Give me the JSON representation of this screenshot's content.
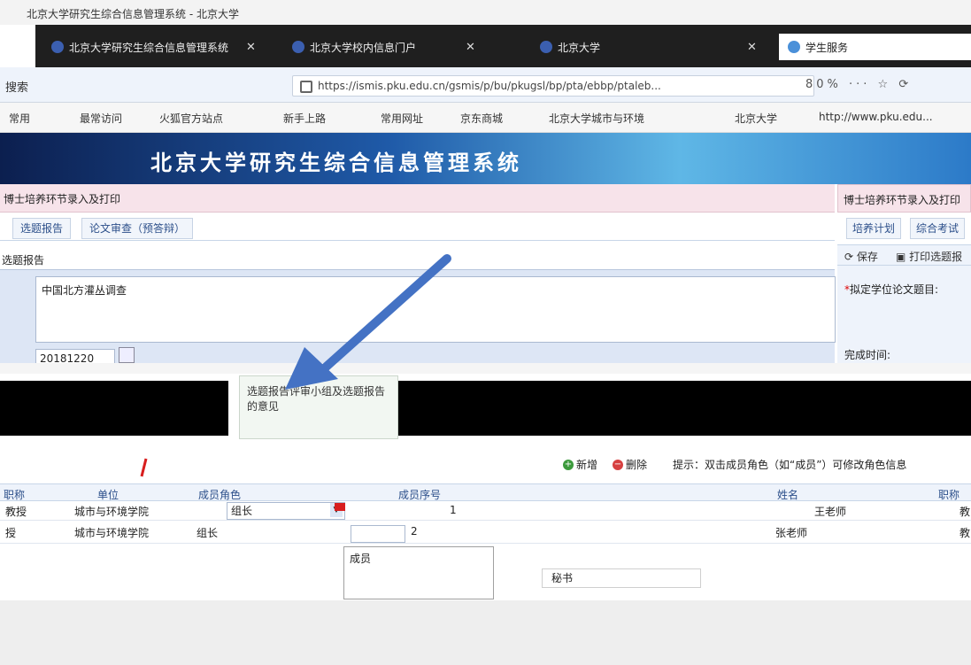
{
  "window": {
    "title": "北京大学研究生综合信息管理系统 - 北京大学"
  },
  "tabs": [
    {
      "label": "北京大学研究生综合信息管理系统",
      "close": "✕"
    },
    {
      "label": "北京大学校内信息门户",
      "close": "✕"
    },
    {
      "label": "北京大学",
      "close": "✕"
    },
    {
      "label": "学生服务"
    }
  ],
  "address": {
    "left": "搜索",
    "url": "https://ismis.pku.edu.cn/gsmis/p/bu/pkugsl/bp/pta/ebbp/ptaleb...",
    "tools": "80% ··· ☆ ⟳"
  },
  "bookmarks": [
    "常用",
    "最常访问",
    "火狐官方站点",
    "新手上路",
    "常用网址",
    "京东商城",
    "北京大学城市与环境",
    "北京大学",
    "http://www.pku.edu..."
  ],
  "banner": {
    "title": "北京大学研究生综合信息管理系统"
  },
  "main": {
    "header": "博士培养环节录入及打印",
    "tabs": [
      "选题报告",
      "论文审查（预答辩）"
    ],
    "section_label": "选题报告",
    "topic": "中国北方灌丛调查",
    "date": "20181220"
  },
  "right_panel": {
    "header": "博士培养环节录入及打印",
    "tabs": [
      "培养计划",
      "综合考试"
    ],
    "save_label": "保存",
    "print_label": "打印选题报",
    "thesis_label": "拟定学位论文题目:",
    "required_mark": "*",
    "time_label": "完成时间:"
  },
  "dialog": {
    "title": "选题报告评审小组及选题报告的意见"
  },
  "committee": {
    "add_label": "新增",
    "delete_label": "删除",
    "hint": "提示：双击成员角色（如“成员”）可修改角色信息"
  },
  "grid": {
    "headers": [
      "职称",
      "单位",
      "成员角色",
      "成员序号",
      "姓名",
      "职称"
    ],
    "rows": [
      {
        "title": "教授",
        "org": "城市与环境学院",
        "role": "组长",
        "seq": "1",
        "name": "王老师",
        "rank": "教"
      },
      {
        "title": "授",
        "org": "城市与环境学院",
        "role": "组长",
        "seq": "2",
        "name": "张老师",
        "rank": "教"
      }
    ]
  },
  "role_options": [
    "成员",
    "秘书"
  ],
  "colors": {
    "accent": "#2c4f8a",
    "arrow": "#4472c4",
    "banner": "#1f5aa8"
  }
}
